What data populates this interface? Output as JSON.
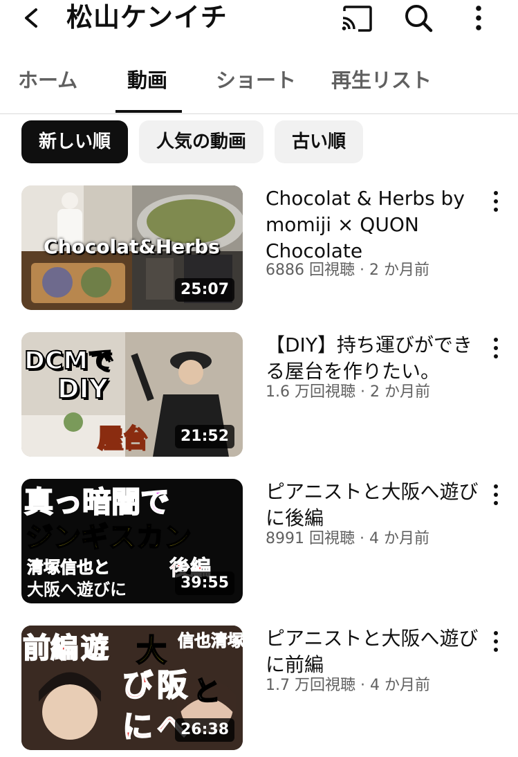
{
  "header": {
    "title": "松山ケンイチ",
    "icons": [
      "back-arrow-icon",
      "cast-icon",
      "search-icon",
      "more-vertical-icon"
    ]
  },
  "tabs": [
    {
      "label": "ホーム",
      "active": false
    },
    {
      "label": "動画",
      "active": true
    },
    {
      "label": "ショート",
      "active": false
    },
    {
      "label": "再生リスト",
      "active": false
    }
  ],
  "chips": [
    {
      "label": "新しい順",
      "active": true
    },
    {
      "label": "人気の動画",
      "active": false
    },
    {
      "label": "古い順",
      "active": false
    }
  ],
  "videos": [
    {
      "title": "Chocolat & Herbs by momiji × QUON Chocolate",
      "meta": "6886 回視聴 · 2 か月前",
      "duration": "25:07",
      "thumb_text": [
        "Chocolat&Herbs"
      ]
    },
    {
      "title": "【DIY】持ち運びができる屋台を作りたい。",
      "meta": "1.6 万回視聴 · 2 か月前",
      "duration": "21:52",
      "thumb_text": [
        "DCMで",
        "DIY",
        "屋台"
      ]
    },
    {
      "title": "ピアニストと大阪へ遊びに後編",
      "meta": "8991 回視聴 · 4 か月前",
      "duration": "39:55",
      "thumb_text": [
        "真っ暗闇で",
        "ジンギスカン",
        "清塚信也と",
        "大阪へ遊びに",
        "後編"
      ]
    },
    {
      "title": "ピアニストと大阪へ遊びに前編",
      "meta": "1.7 万回視聴 · 4 か月前",
      "duration": "26:38",
      "thumb_text": [
        "前編",
        "遊",
        "び",
        "に",
        "大",
        "阪",
        "へ",
        "と",
        "信也",
        "清塚"
      ]
    }
  ],
  "colors": {
    "text_primary": "#0f0f0f",
    "text_secondary": "#606060",
    "chip_bg": "#f1f1f1",
    "chip_active_bg": "#0f0f0f"
  }
}
